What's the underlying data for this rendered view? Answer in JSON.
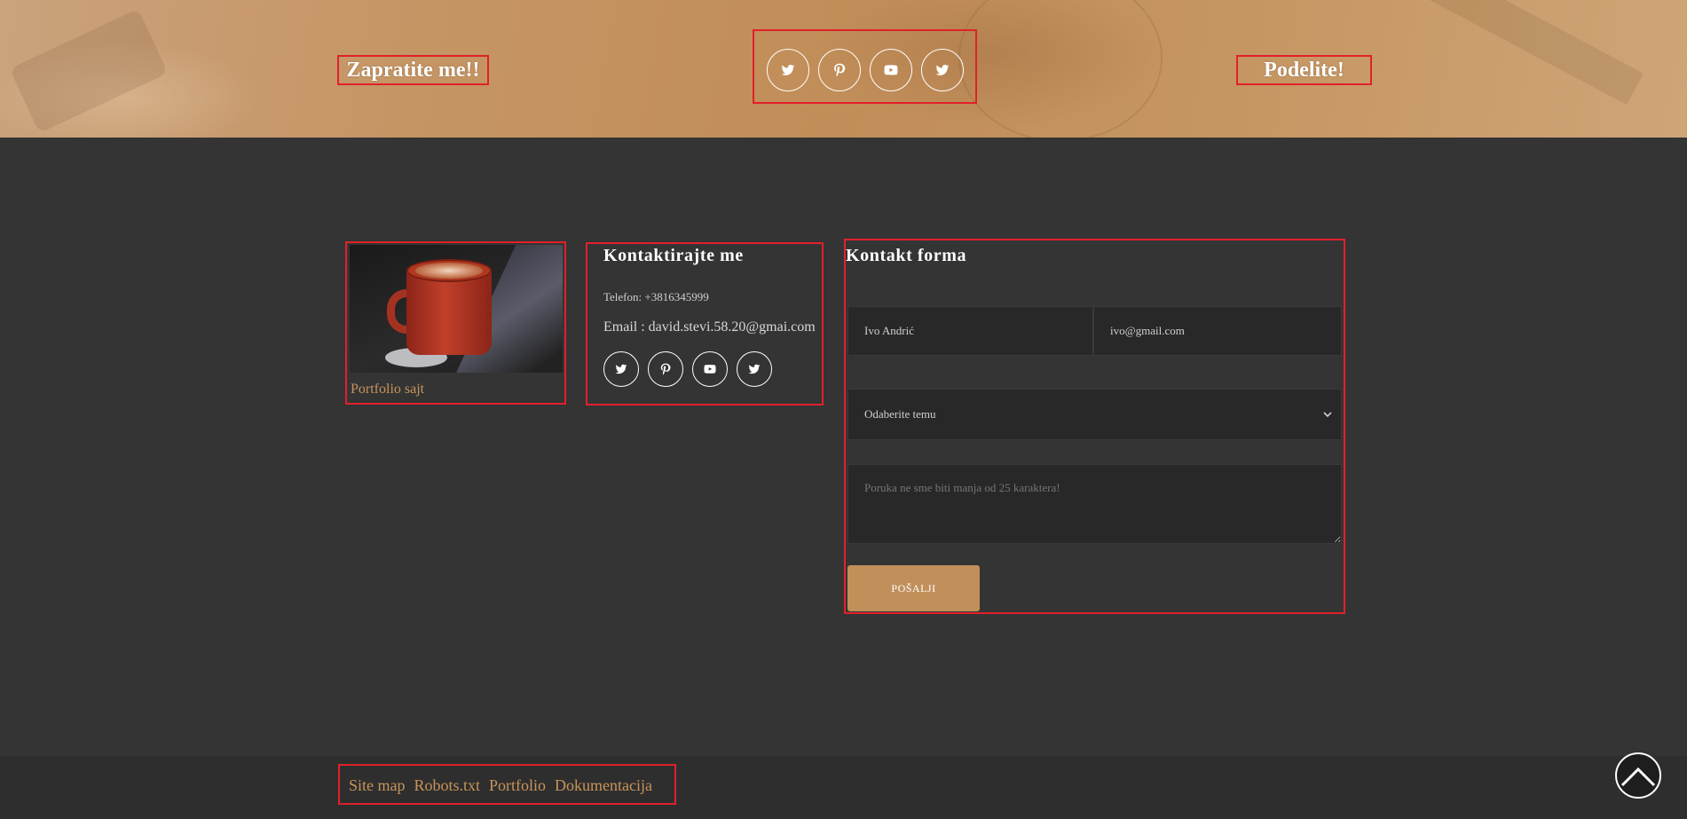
{
  "banner": {
    "follow_title": "Zapratite me!!",
    "share_title": "Podelite!",
    "social_icons": [
      "twitter-icon",
      "pinterest-icon",
      "youtube-icon",
      "twitter-icon"
    ]
  },
  "portfolio": {
    "caption": "Portfolio sajt"
  },
  "contact": {
    "title": "Kontaktirajte me",
    "phone": "Telefon: +3816345999",
    "email": "Email : david.stevi.58.20@gmai.com",
    "social_icons": [
      "twitter-icon",
      "pinterest-icon",
      "youtube-icon",
      "twitter-icon"
    ]
  },
  "form": {
    "title": "Kontakt forma",
    "name_value": "Ivo Andrić",
    "email_value": "ivo@gmail.com",
    "topic_selected": "Odaberite temu",
    "message_placeholder": "Poruka ne sme biti manja od 25 karaktera!",
    "send_label": "POŠALJI"
  },
  "footer": {
    "links": [
      "Site map",
      "Robots.txt",
      "Portfolio",
      "Dokumentacija"
    ]
  },
  "colors": {
    "accent": "#c18f5a",
    "background": "#343434",
    "bottom_bar": "#2e2e2e",
    "highlight_box": "#e0212a"
  }
}
